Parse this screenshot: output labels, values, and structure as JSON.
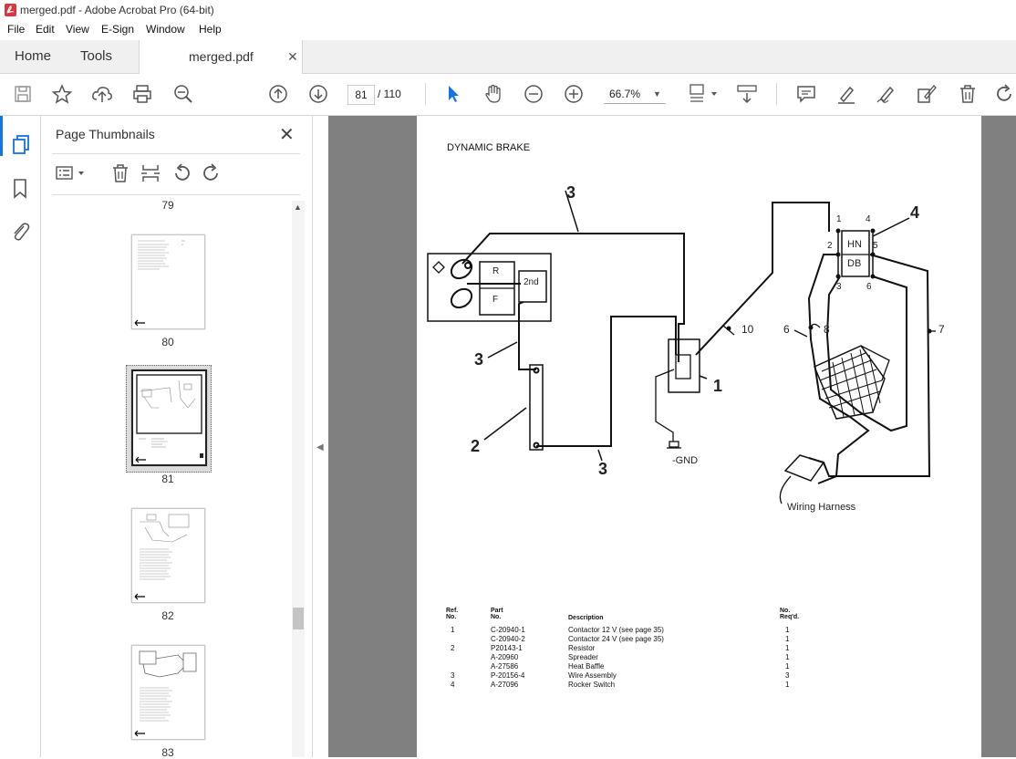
{
  "window": {
    "title": "merged.pdf - Adobe Acrobat Pro (64-bit)"
  },
  "menu": [
    "File",
    "Edit",
    "View",
    "E-Sign",
    "Window",
    "Help"
  ],
  "tabs": {
    "home": "Home",
    "tools": "Tools",
    "document": "merged.pdf"
  },
  "toolbar": {
    "current_page": "81",
    "total_pages": "/ 110",
    "zoom": "66.7%"
  },
  "panel": {
    "title": "Page Thumbnails",
    "thumbnails": [
      "79",
      "80",
      "81",
      "82",
      "83"
    ]
  },
  "document": {
    "heading": "DYNAMIC BRAKE",
    "diagram_labels": {
      "ref3_top": "3",
      "ref3_left": "3",
      "ref3_bottom": "3",
      "ref2": "2",
      "ref1": "1",
      "ref4": "4",
      "ref10": "10",
      "ref6": "6",
      "ref8": "8",
      "ref7": "7",
      "gnd": "GND",
      "switch_hn": "HN",
      "switch_db": "DB",
      "pin1": "1",
      "pin2": "2",
      "pin3": "3",
      "pin4": "4",
      "pin5": "5",
      "pin6": "6",
      "box_r": "R",
      "box_f": "F",
      "box_2nd": "2nd",
      "harness": "Wiring Harness"
    },
    "parts_table": {
      "headers": {
        "ref": "Ref.\nNo.",
        "part": "Part\nNo.",
        "desc": "Description",
        "req": "No.\nReq'd."
      },
      "rows": [
        {
          "ref": "1",
          "part": "C-20940-1",
          "desc": "Contactor 12 V (see page 35)",
          "req": "1"
        },
        {
          "ref": "",
          "part": "C-20940-2",
          "desc": "Contactor 24 V (see page 35)",
          "req": "1"
        },
        {
          "ref": "2",
          "part": "P20143-1",
          "desc": "Resistor",
          "req": "1"
        },
        {
          "ref": "",
          "part": "A-20960",
          "desc": "Spreader",
          "req": "1"
        },
        {
          "ref": "",
          "part": "A-27586",
          "desc": "Heat Baffle",
          "req": "1"
        },
        {
          "ref": "3",
          "part": "P-20156-4",
          "desc": "Wire Assembly",
          "req": "3"
        },
        {
          "ref": "4",
          "part": "A-27096",
          "desc": "Rocker Switch",
          "req": "1"
        }
      ]
    }
  },
  "colors": {
    "accent": "#1473e6",
    "acrobat_red": "#d7373f",
    "doc_bg": "#808080"
  }
}
